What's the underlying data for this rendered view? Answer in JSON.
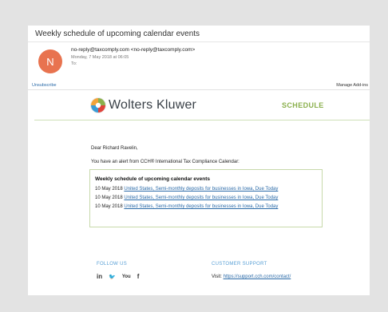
{
  "email": {
    "subject": "Weekly schedule of upcoming calendar events",
    "avatar_letter": "N",
    "sender": "no-reply@taxcomply.com <no-reply@taxcomply.com>",
    "date": "Monday, 7 May 2018 at 06:05",
    "to": "To:",
    "unsubscribe": "Unsubscribe",
    "manage": "Manage Add-ins"
  },
  "body": {
    "brand": "Wolters Kluwer",
    "tag": "SCHEDULE",
    "greeting": "Dear Richard Ravelin,",
    "alert": "You have an alert from CCH® International Tax Compliance Calendar:",
    "box_title": "Weekly schedule of upcoming calendar events",
    "rows": [
      {
        "date": "10 May 2018",
        "text": "United States, Semi-monthly deposits for businesses in Iowa, Due Today"
      },
      {
        "date": "10 May 2018",
        "text": "United States, Semi-monthly deposits for businesses in Iowa, Due Today"
      },
      {
        "date": "10 May 2018",
        "text": "United States, Semi-monthly deposits for businesses in Iowa, Due Today"
      }
    ]
  },
  "footer": {
    "follow": "FOLLOW US",
    "support": "CUSTOMER SUPPORT",
    "visit_label": "Visit: ",
    "visit_link": "https://support.cch.com/contact/",
    "socials": [
      "in",
      "🐦",
      "You",
      "f"
    ]
  },
  "colors": {
    "avatar": "#e8734f",
    "accent_green": "#8bb04d",
    "link_blue": "#2a6aa8"
  }
}
